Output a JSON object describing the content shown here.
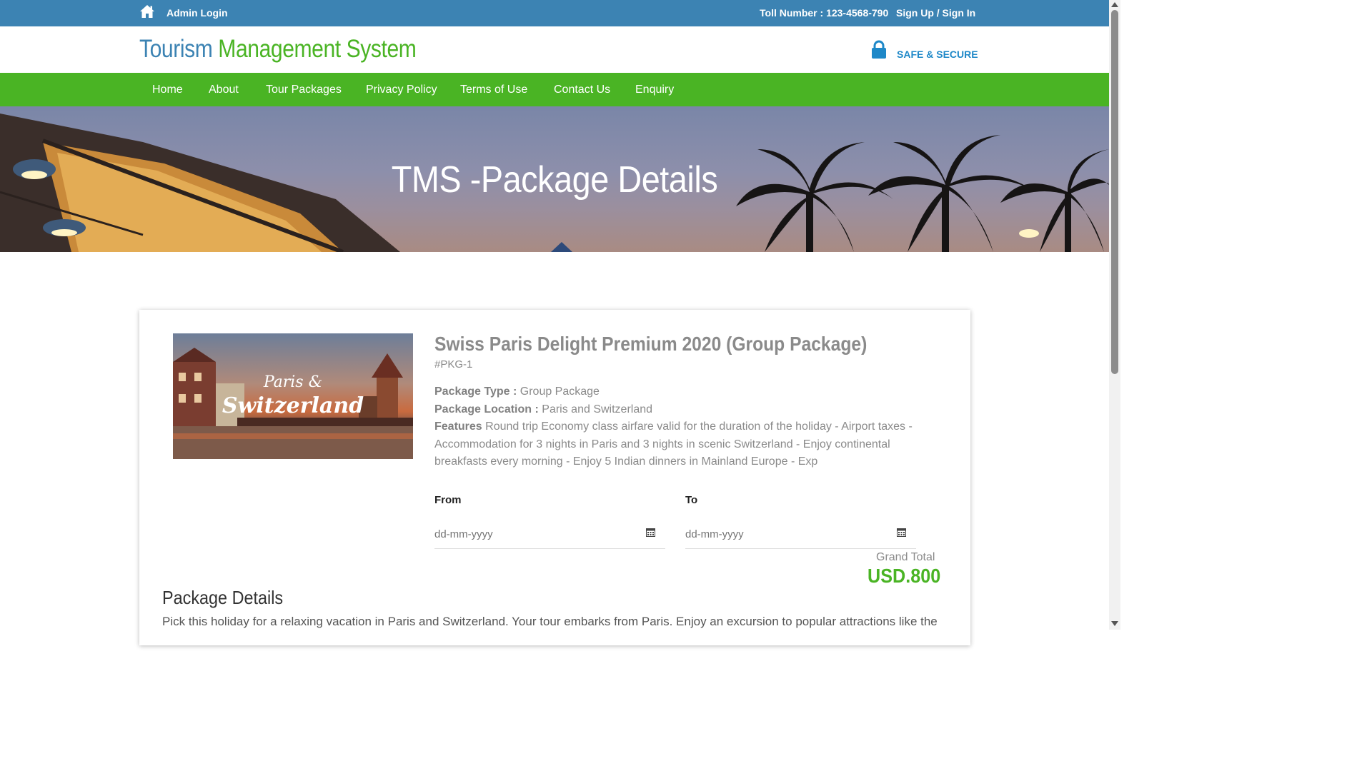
{
  "topbar": {
    "admin_login": "Admin Login",
    "toll": "Toll Number : 123-4568-790",
    "signup": "Sign Up / Sign In"
  },
  "header": {
    "logo_part1": "Tourism",
    "logo_part2": "Management System",
    "safe_label": "SAFE & SECURE"
  },
  "nav": {
    "items": [
      {
        "label": "Home"
      },
      {
        "label": "About"
      },
      {
        "label": "Tour Packages"
      },
      {
        "label": "Privacy Policy"
      },
      {
        "label": "Terms of Use"
      },
      {
        "label": "Contact Us"
      },
      {
        "label": "Enquiry"
      }
    ]
  },
  "banner": {
    "title": "TMS -Package Details"
  },
  "package": {
    "image_text_line1": "Paris &",
    "image_text_line2": "Switzerland",
    "name": "Swiss Paris Delight Premium 2020 (Group Package)",
    "id": "#PKG-1",
    "type_label": "Package Type :",
    "type_value": "Group Package",
    "location_label": "Package Location :",
    "location_value": "Paris and Switzerland",
    "features_label": "Features",
    "features_value": "Round trip Economy class airfare valid for the duration of the holiday - Airport taxes - Accommodation for 3 nights in Paris and 3 nights in scenic Switzerland - Enjoy continental breakfasts every morning - Enjoy 5 Indian dinners in Mainland Europe - Exp"
  },
  "booking": {
    "from_label": "From",
    "to_label": "To",
    "from_placeholder": "dd-mm-yyyy",
    "to_placeholder": "dd-mm-yyyy",
    "grand_total_label": "Grand Total",
    "grand_total_value": "USD.800"
  },
  "details": {
    "heading": "Package Details",
    "text": "Pick this holiday for a relaxing vacation in Paris and Switzerland. Your tour embarks from Paris. Enjoy an excursion to popular attractions like the"
  },
  "colors": {
    "topbar": "#3c83b3",
    "nav": "#4ab424",
    "accent_green": "#4ab424",
    "accent_blue": "#3c83b3"
  }
}
